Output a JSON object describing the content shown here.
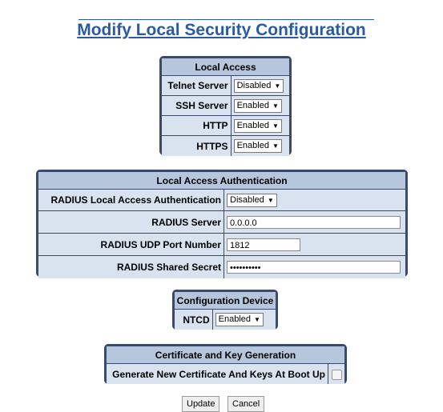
{
  "title": "Modify Local Security Configuration",
  "local_access": {
    "header": "Local Access",
    "rows": [
      {
        "label": "Telnet Server",
        "value": "Disabled"
      },
      {
        "label": "SSH Server",
        "value": "Enabled"
      },
      {
        "label": "HTTP",
        "value": "Enabled"
      },
      {
        "label": "HTTPS",
        "value": "Enabled"
      }
    ]
  },
  "auth": {
    "header": "Local Access Authentication",
    "radius_local_label": "RADIUS Local Access Authentication",
    "radius_local_value": "Disabled",
    "radius_server_label": "RADIUS Server",
    "radius_server_value": "0.0.0.0",
    "udp_port_label": "RADIUS UDP Port Number",
    "udp_port_value": "1812",
    "shared_secret_label": "RADIUS Shared Secret",
    "shared_secret_value": "••••••••••"
  },
  "config_device": {
    "header": "Configuration Device",
    "label": "NTCD",
    "value": "Enabled"
  },
  "cert": {
    "header": "Certificate and Key Generation",
    "label": "Generate New Certificate And Keys At Boot Up"
  },
  "buttons": {
    "update": "Update",
    "cancel": "Cancel"
  },
  "icons": {
    "dropdown": "chevron-down-icon"
  }
}
